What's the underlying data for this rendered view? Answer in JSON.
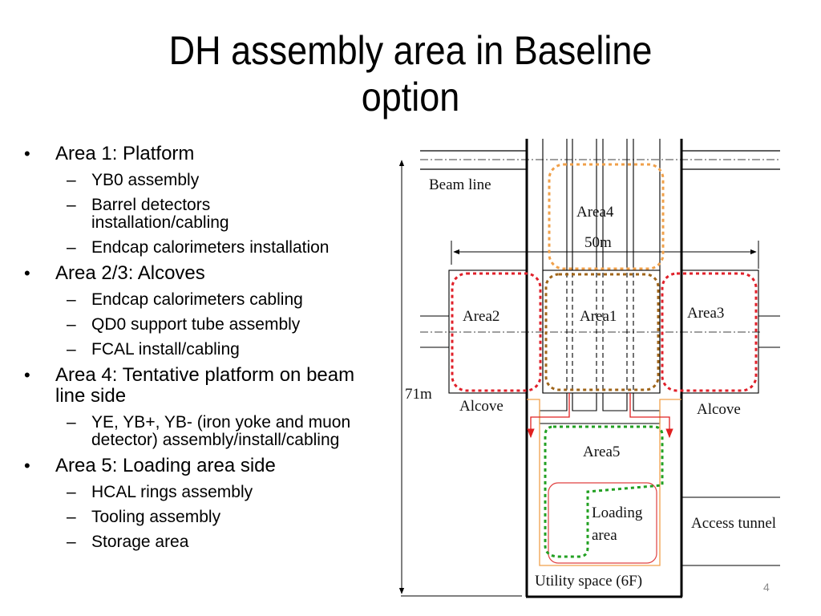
{
  "slide": {
    "title_line1": "DH assembly area in Baseline",
    "title_line2": "option",
    "page_number": "4"
  },
  "bullets": [
    {
      "level": 1,
      "text": "Area 1: Platform"
    },
    {
      "level": 2,
      "text": "YB0 assembly"
    },
    {
      "level": 2,
      "text": "Barrel detectors installation/cabling"
    },
    {
      "level": 2,
      "text": "Endcap calorimeters installation"
    },
    {
      "level": 1,
      "text": "Area 2/3: Alcoves"
    },
    {
      "level": 2,
      "text": "Endcap calorimeters cabling"
    },
    {
      "level": 2,
      "text": "QD0 support tube assembly"
    },
    {
      "level": 2,
      "text": "FCAL install/cabling"
    },
    {
      "level": 1,
      "text": "Area 4: Tentative platform on beam line side"
    },
    {
      "level": 2,
      "text": "YE, YB+, YB- (iron yoke and muon detector) assembly/install/cabling"
    },
    {
      "level": 1,
      "text": "Area 5: Loading area side"
    },
    {
      "level": 2,
      "text": "HCAL rings assembly"
    },
    {
      "level": 2,
      "text": "Tooling assembly"
    },
    {
      "level": 2,
      "text": "Storage area"
    }
  ],
  "bullet_marks": {
    "level1": "•",
    "level2": "–"
  },
  "diagram": {
    "labels": {
      "beam_line": "Beam line",
      "area4": "Area4",
      "width_dim": "50m",
      "area2": "Area2",
      "area1": "Area1",
      "area3": "Area3",
      "height_dim": "71m",
      "alcove_left": "Alcove",
      "alcove_right": "Alcove",
      "area5": "Area5",
      "loading_line1": "Loading",
      "loading_line2": "area",
      "access_tunnel": "Access tunnel",
      "utility_space": "Utility space (6F)"
    },
    "colors": {
      "area4_outline": "#f0a04a",
      "area1_outline": "#a0651a",
      "alcove_outline": "#e0202a",
      "area5_outline": "#22a022",
      "loading_outline": "#e04040",
      "utility_outline": "#f0a04a",
      "arrow": "#e02020"
    }
  }
}
